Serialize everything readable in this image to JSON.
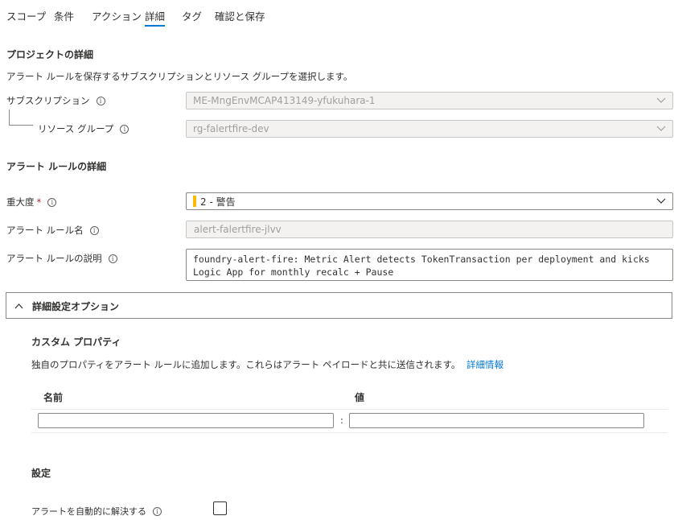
{
  "tabs": [
    {
      "label": "スコープ",
      "active": false
    },
    {
      "label": "条件",
      "active": false
    },
    {
      "label": "アクション",
      "active": false
    },
    {
      "label": "詳細",
      "active": true
    },
    {
      "label": "タグ",
      "active": false
    },
    {
      "label": "確認と保存",
      "active": false
    }
  ],
  "project": {
    "heading": "プロジェクトの詳細",
    "description": "アラート ルールを保存するサブスクリプションとリソース グループを選択します。",
    "subscription_label": "サブスクリプション",
    "subscription_value": "ME-MngEnvMCAP413149-yfukuhara-1",
    "resource_group_label": "リソース グループ",
    "resource_group_value": "rg-falertfire-dev"
  },
  "rule": {
    "heading": "アラート ルールの詳細",
    "severity_label": "重大度",
    "required_mark": "*",
    "severity_value": "2 - 警告",
    "severity_color": "#ffb900",
    "name_label": "アラート ルール名",
    "name_value": "alert-falertfire-jlvv",
    "description_label": "アラート ルールの説明",
    "description_value": "foundry-alert-fire: Metric Alert detects TokenTransaction per deployment and kicks Logic App for monthly recalc + Pause"
  },
  "advanced": {
    "title": "詳細設定オプション",
    "expanded": true,
    "custom_props_heading": "カスタム プロパティ",
    "custom_props_description": "独自のプロパティをアラート ルールに追加します。これらはアラート ペイロードと共に送信されます。",
    "learn_more": "詳細情報",
    "name_column": "名前",
    "value_column": "値",
    "separator": ":",
    "name_input_value": "",
    "value_input_value": "",
    "settings_heading": "設定",
    "auto_resolve_label": "アラートを自動的に解決する",
    "auto_resolve_checked": false
  },
  "icons": {
    "info": "info-icon",
    "chevron": "chevron-down-icon",
    "collapse": "chevron-up-icon"
  },
  "colors": {
    "accent": "#0078d4",
    "link": "#0078d4",
    "required": "#a4262c"
  }
}
